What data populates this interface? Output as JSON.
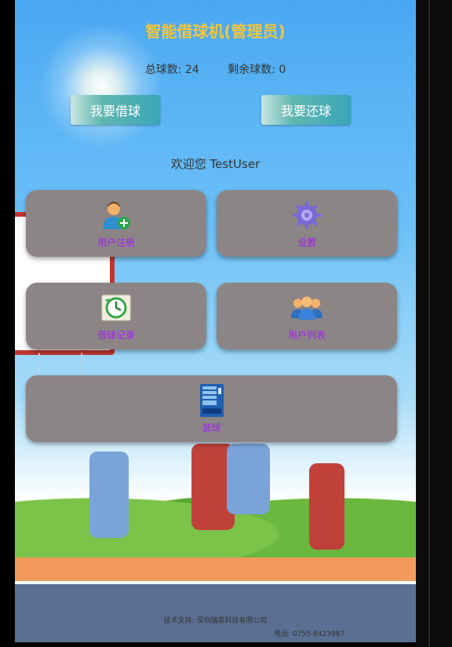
{
  "header": {
    "title": "智能借球机(管理员)",
    "total_balls": "总球数: 24",
    "remaining_balls": "剩余球数: 0"
  },
  "actions": {
    "borrow_label": "我要借球",
    "return_label": "我要还球"
  },
  "welcome": "欢迎您 TestUser",
  "menu": {
    "user_register": "用户注册",
    "settings": "设置",
    "borrow_records": "借球记录",
    "user_list": "用户列表",
    "load_balls": "装球"
  },
  "footer": {
    "tech_support": "技术支持: 深圳瑞菜科技有限公司",
    "phone": "电话: 0755-8423987"
  },
  "colors": {
    "title": "#f3c63a",
    "card": "#8c8585",
    "card_label": "#a020f0"
  }
}
